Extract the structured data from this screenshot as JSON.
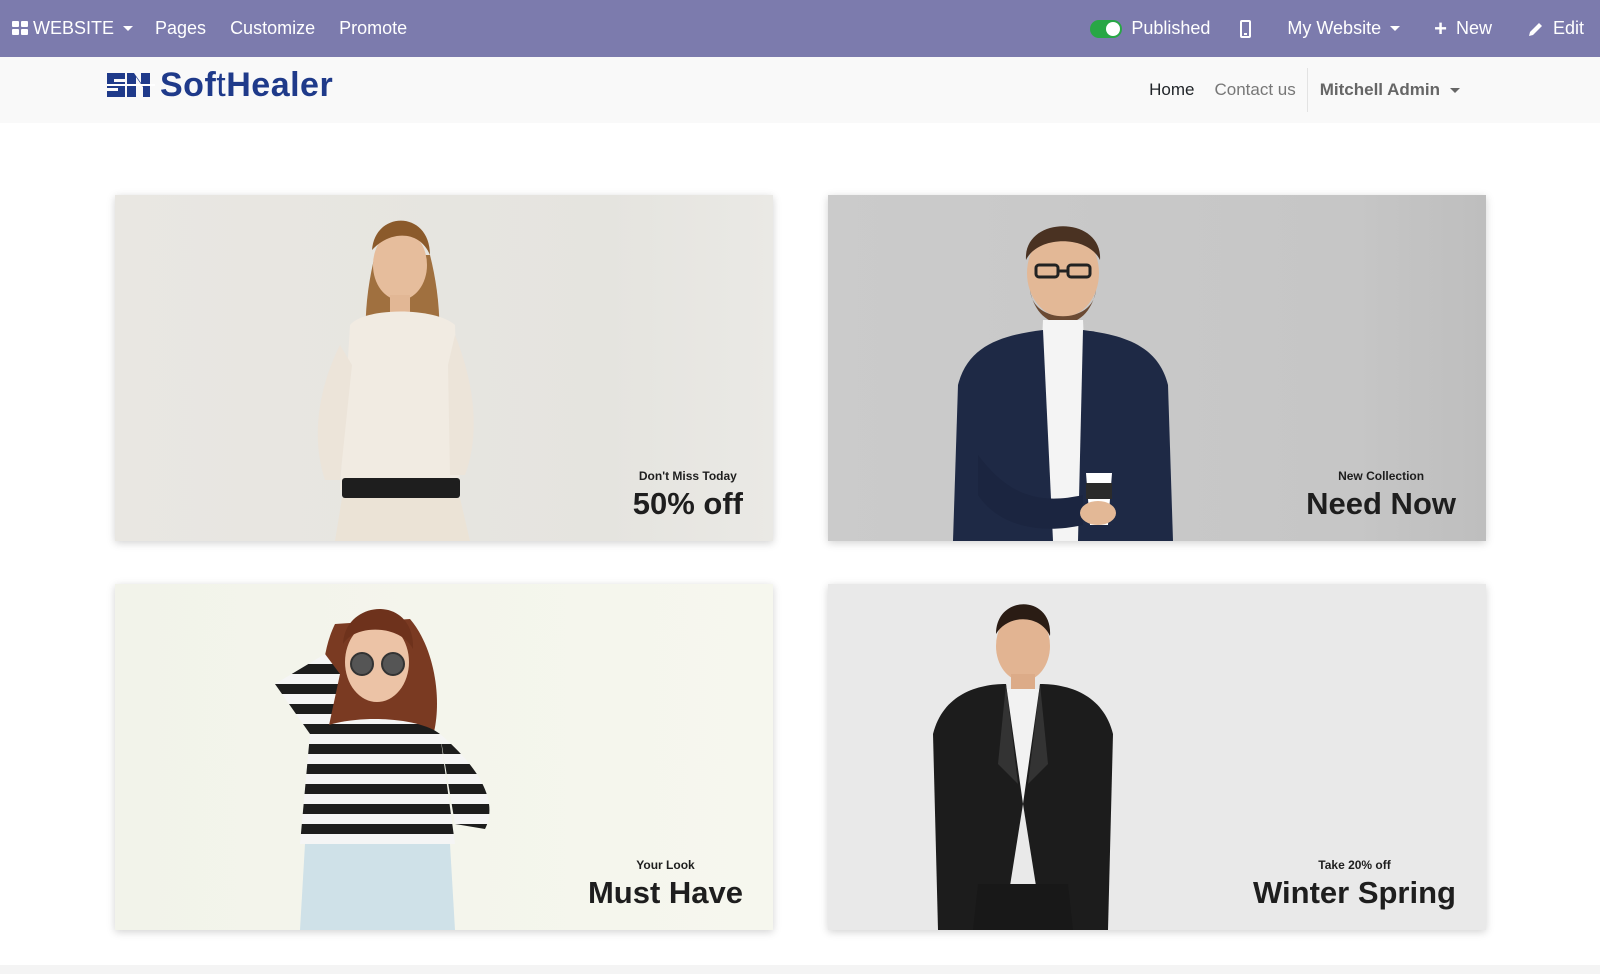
{
  "topbar": {
    "apps_label": "WEBSITE",
    "menu": [
      "Pages",
      "Customize",
      "Promote"
    ],
    "published_label": "Published",
    "website_label": "My Website",
    "new_label": "New",
    "edit_label": "Edit",
    "bar_color": "#7c7bad"
  },
  "header": {
    "logo_text_a": "Sof",
    "logo_text_b": "t",
    "logo_text_c": "Healer",
    "nav": [
      "Home",
      "Contact us"
    ],
    "user": "Mitchell Admin"
  },
  "banners": [
    {
      "subtitle": "Don't Miss Today",
      "title": "50% off"
    },
    {
      "subtitle": "New Collection",
      "title": "Need Now"
    },
    {
      "subtitle": "Your Look",
      "title": "Must Have"
    },
    {
      "subtitle": "Take 20% off",
      "title": "Winter Spring"
    }
  ]
}
